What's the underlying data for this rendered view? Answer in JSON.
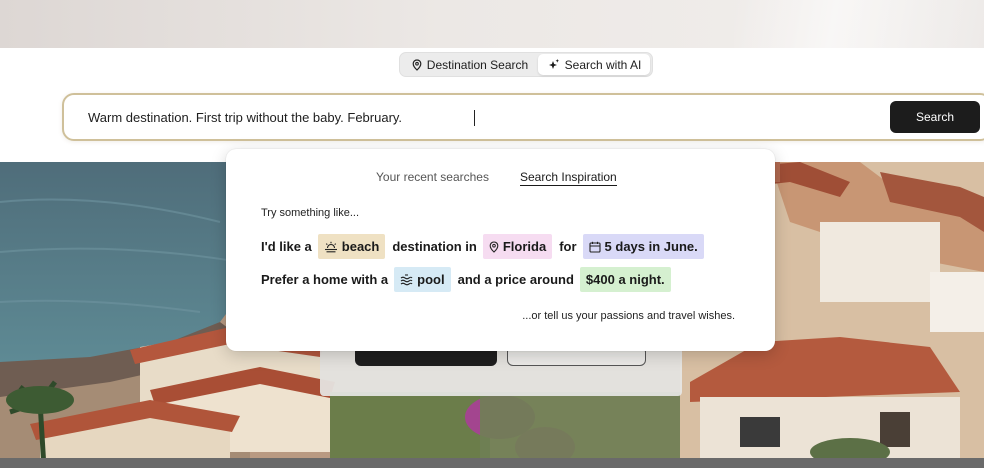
{
  "mode_toggle": {
    "destination_label": "Destination Search",
    "ai_label": "Search with AI",
    "active": "ai"
  },
  "search": {
    "value": "Warm destination. First trip without the baby. February.",
    "button_label": "Search"
  },
  "popover": {
    "tabs": [
      {
        "label": "Your recent searches",
        "active": false
      },
      {
        "label": "Search Inspiration",
        "active": true
      }
    ],
    "try_label": "Try something like...",
    "sentence1": {
      "w1": "I'd like a",
      "chip_beach": "beach",
      "w2": "destination in",
      "chip_location": "Florida",
      "w3": "for",
      "chip_dates": "5 days in June."
    },
    "sentence2": {
      "w1": "Prefer a home with a",
      "chip_amenity": "pool",
      "w2": "and a price around",
      "chip_price": "$400 a night."
    },
    "footer": "...or tell us your passions and travel wishes."
  },
  "colors": {
    "accent_border": "#cfc09a",
    "button_dark": "#1c1c1c",
    "chip_beach": "#efe1c3",
    "chip_location": "#f6dcf1",
    "chip_dates": "#d9d9f7",
    "chip_pool": "#d6eaf5",
    "chip_price": "#d5f0d0"
  },
  "icons": {
    "destination": "map-pin-icon",
    "ai": "sparkle-icon",
    "beach": "sunset-icon",
    "location": "map-pin-icon",
    "dates": "calendar-icon",
    "pool": "pool-icon"
  }
}
